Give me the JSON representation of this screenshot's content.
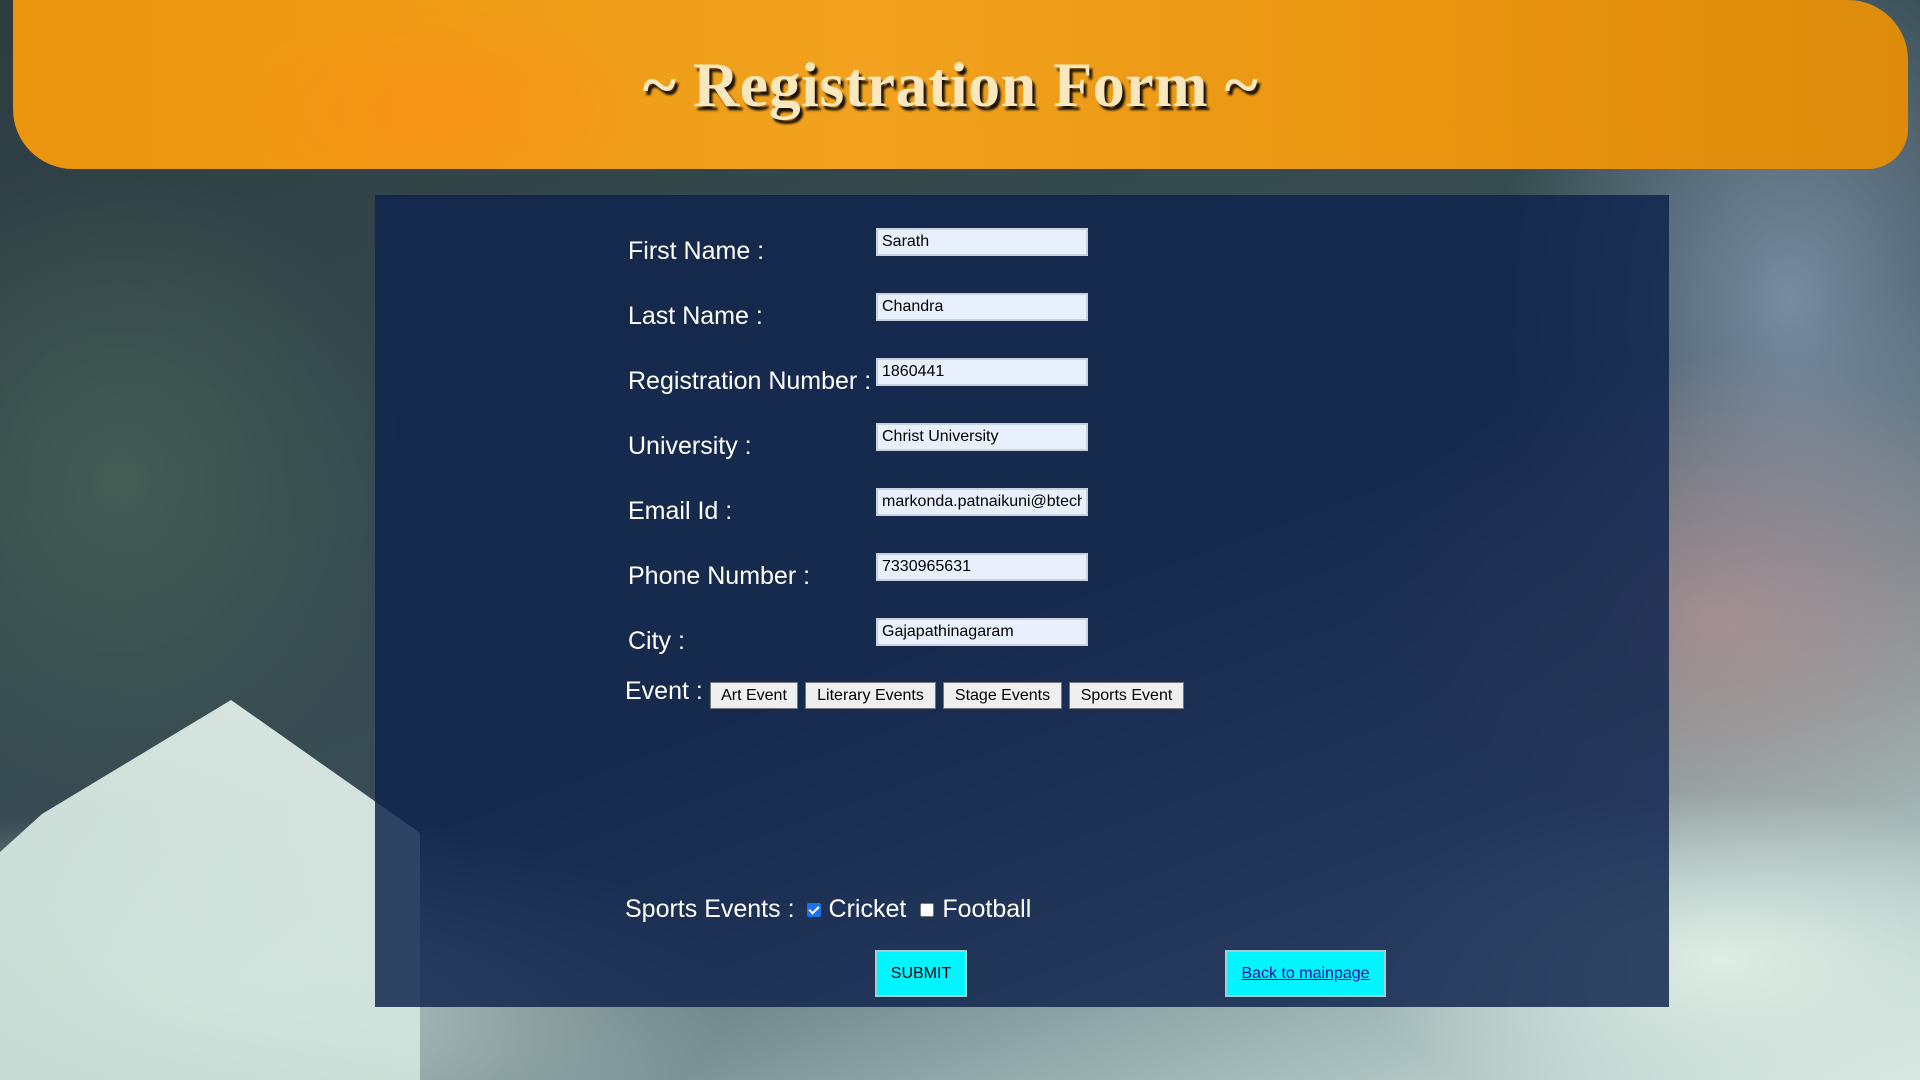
{
  "header": {
    "title": "~ Registration Form ~",
    "background_color": "#f09a18"
  },
  "form": {
    "fields": [
      {
        "label": "First Name :",
        "value": "Sarath"
      },
      {
        "label": "Last Name :",
        "value": "Chandra"
      },
      {
        "label": "Registration Number :",
        "value": "1860441"
      },
      {
        "label": "University :",
        "value": "Christ University"
      },
      {
        "label": "Email Id :",
        "value": "markonda.patnaikuni@btech.christuniversity.in"
      },
      {
        "label": "Phone Number :",
        "value": "7330965631"
      },
      {
        "label": "City :",
        "value": "Gajapathinagaram"
      }
    ],
    "event": {
      "label": "Event :",
      "buttons": [
        "Art Event",
        "Literary Events",
        "Stage Events",
        "Sports Event"
      ]
    },
    "sports_events": {
      "label": "Sports Events :",
      "options": [
        {
          "label": "Cricket",
          "checked": true
        },
        {
          "label": "Football",
          "checked": false
        }
      ]
    },
    "submit_label": "SUBMIT",
    "back_label": "Back to mainpage",
    "accent_color": "#00f5ff",
    "panel_color": "#10244e"
  }
}
